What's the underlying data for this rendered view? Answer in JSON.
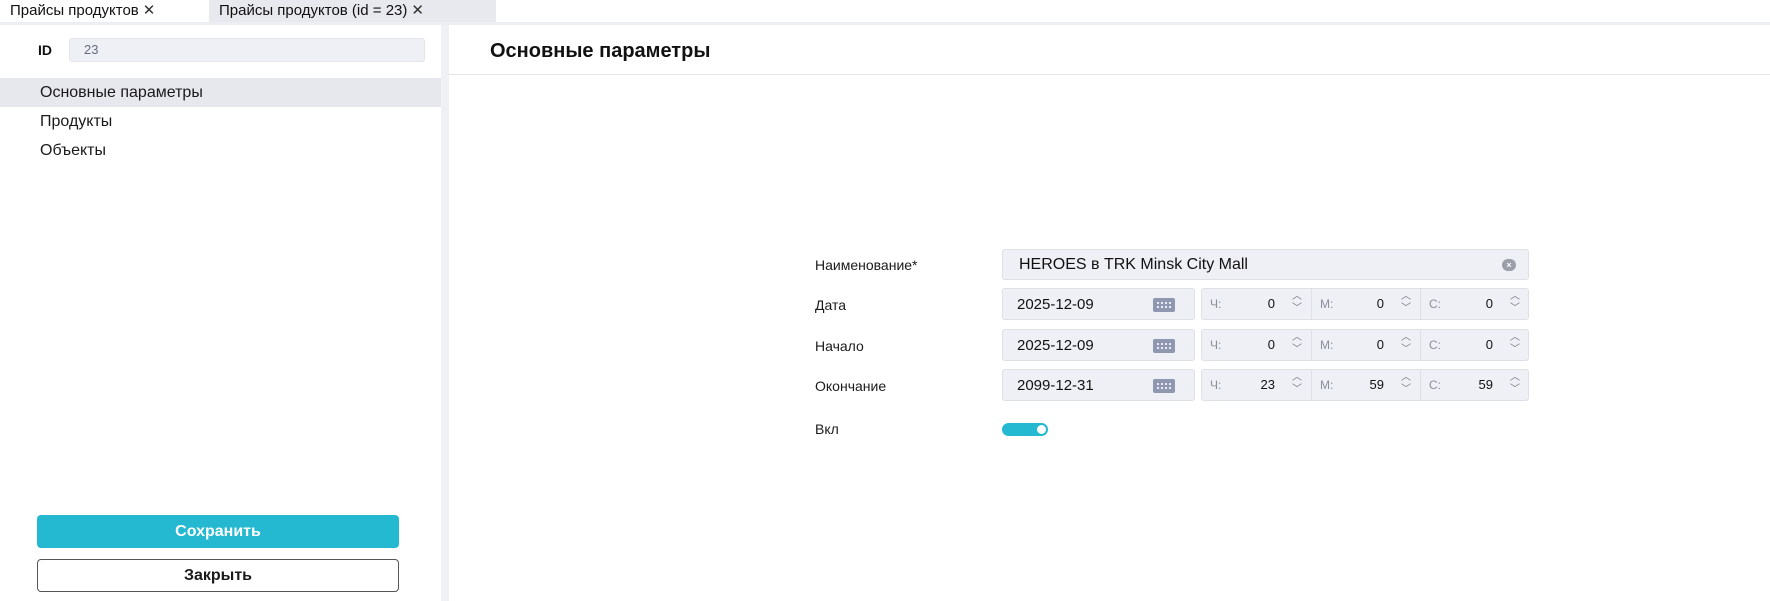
{
  "tabs": [
    {
      "label": "Прайсы продуктов",
      "close": "✕"
    },
    {
      "label": "Прайсы продуктов (id = 23)",
      "close": "✕"
    }
  ],
  "sidebar": {
    "id_label": "ID",
    "id_value": "23",
    "items": [
      {
        "label": "Основные параметры",
        "active": true
      },
      {
        "label": "Продукты",
        "active": false
      },
      {
        "label": "Объекты",
        "active": false
      }
    ],
    "save_label": "Сохранить",
    "close_label": "Закрыть"
  },
  "main": {
    "title": "Основные параметры",
    "form": {
      "name_label": "Наименование*",
      "name_value": "HEROES в TRK Minsk City Mall",
      "date_label": "Дата",
      "start_label": "Начало",
      "end_label": "Окончание",
      "enabled_label": "Вкл",
      "enabled": true,
      "time_labels": {
        "h": "Ч:",
        "m": "М:",
        "s": "С:"
      },
      "rows": [
        {
          "date": "2025-12-09",
          "h": "0",
          "m": "0",
          "s": "0"
        },
        {
          "date": "2025-12-09",
          "h": "0",
          "m": "0",
          "s": "0"
        },
        {
          "date": "2099-12-31",
          "h": "23",
          "m": "59",
          "s": "59"
        }
      ]
    }
  },
  "icons": {
    "clear": "clear-icon",
    "calendar": "calendar-icon",
    "spin_up": "chevron-up-icon",
    "spin_down": "chevron-down-icon"
  },
  "colors": {
    "accent": "#24b9d0",
    "field_bg": "#eef0f5",
    "active_nav_bg": "#e6e8ee"
  }
}
